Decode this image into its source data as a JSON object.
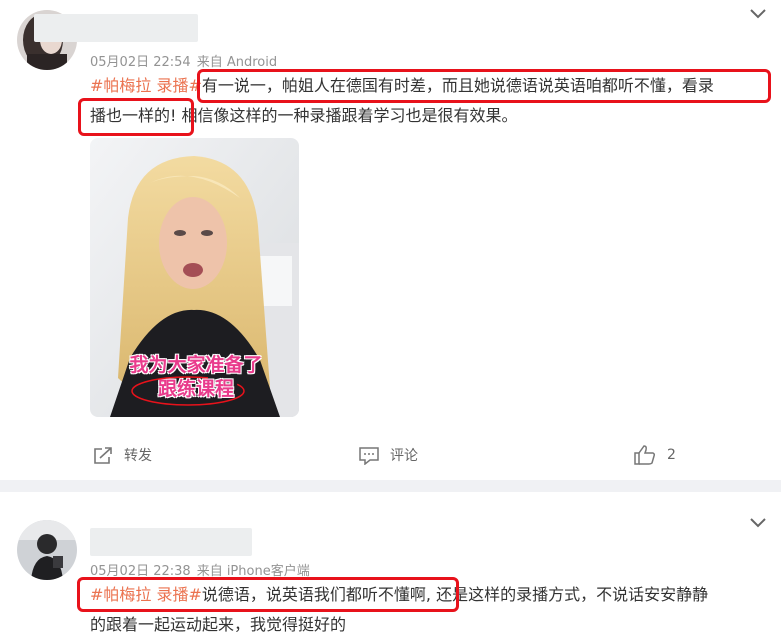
{
  "posts": [
    {
      "meta": {
        "time": "05月02日 22:54",
        "source": "来自 Android"
      },
      "text": {
        "hashtag": "#帕梅拉 录播#",
        "line1": "有一说一，帕姐人在德国有时差，而且她说德语说英语咱都听不懂，看录",
        "line2_highlight": "播也一样的!",
        "line2_rest": "相信像这样的一种录播跟着学习也是很有效果。"
      },
      "image": {
        "overlay_line1": "我为大家准备了",
        "overlay_line2": "跟练课程"
      },
      "actions": {
        "forward": "转发",
        "comment": "评论",
        "like_count": "2"
      }
    },
    {
      "meta": {
        "time": "05月02日 22:38",
        "source": "来自 iPhone客户端"
      },
      "text": {
        "hashtag": "#帕梅拉 录播#",
        "line1_highlight": "说德语，说英语我们都听不懂啊,",
        "line1_rest": "还是这样的录播方式，不说话安安静静",
        "line2": "的跟着一起运动起来，我觉得挺好的"
      }
    }
  ],
  "colors": {
    "hashtag": "#eb7350",
    "highlight_box": "#e8121b",
    "separator": "#f0f1f4"
  },
  "icons": [
    "chevron-down-icon",
    "forward-icon",
    "comment-icon",
    "thumbs-up-icon"
  ]
}
